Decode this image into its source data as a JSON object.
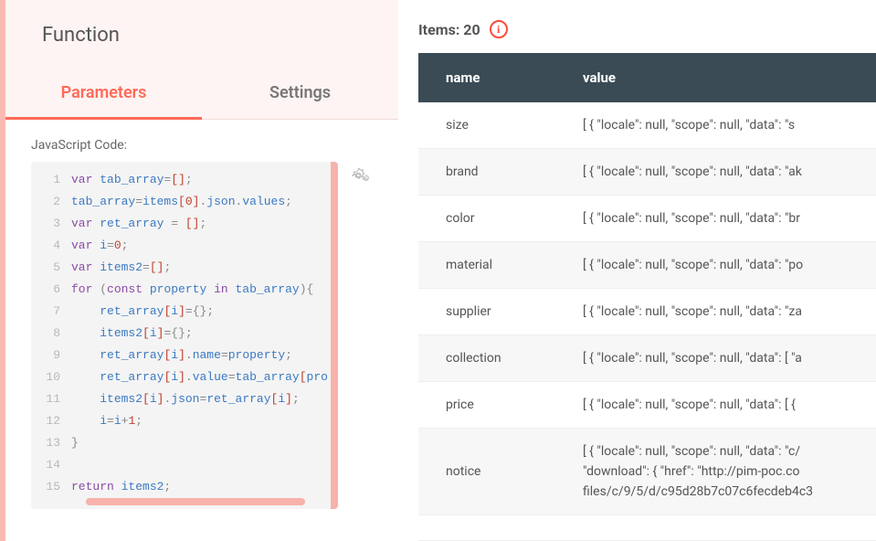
{
  "left": {
    "title": "Function",
    "tabs": {
      "parameters": "Parameters",
      "settings": "Settings"
    },
    "field_label": "JavaScript Code:",
    "code_lines": [
      [
        {
          "t": "var ",
          "c": "kw"
        },
        {
          "t": "tab_array",
          "c": "prop"
        },
        {
          "t": "=",
          "c": "op"
        },
        {
          "t": "[",
          "c": "bracket"
        },
        {
          "t": "]",
          "c": "bracket"
        },
        {
          "t": ";",
          "c": "punct"
        }
      ],
      [
        {
          "t": "tab_array",
          "c": "prop"
        },
        {
          "t": "=",
          "c": "op"
        },
        {
          "t": "items",
          "c": "prop"
        },
        {
          "t": "[",
          "c": "bracket"
        },
        {
          "t": "0",
          "c": "num"
        },
        {
          "t": "]",
          "c": "bracket"
        },
        {
          "t": ".",
          "c": "punct"
        },
        {
          "t": "json",
          "c": "prop"
        },
        {
          "t": ".",
          "c": "punct"
        },
        {
          "t": "values",
          "c": "prop"
        },
        {
          "t": ";",
          "c": "punct"
        }
      ],
      [
        {
          "t": "var ",
          "c": "kw"
        },
        {
          "t": "ret_array ",
          "c": "prop"
        },
        {
          "t": "=",
          "c": "op"
        },
        {
          "t": " ",
          "c": "id"
        },
        {
          "t": "[",
          "c": "bracket"
        },
        {
          "t": "]",
          "c": "bracket"
        },
        {
          "t": ";",
          "c": "punct"
        }
      ],
      [
        {
          "t": "var ",
          "c": "kw"
        },
        {
          "t": "i",
          "c": "prop"
        },
        {
          "t": "=",
          "c": "op"
        },
        {
          "t": "0",
          "c": "num"
        },
        {
          "t": ";",
          "c": "punct"
        }
      ],
      [
        {
          "t": "var ",
          "c": "kw"
        },
        {
          "t": "items2",
          "c": "prop"
        },
        {
          "t": "=",
          "c": "op"
        },
        {
          "t": "[",
          "c": "bracket"
        },
        {
          "t": "]",
          "c": "bracket"
        },
        {
          "t": ";",
          "c": "punct"
        }
      ],
      [
        {
          "t": "for ",
          "c": "kw"
        },
        {
          "t": "(",
          "c": "punct"
        },
        {
          "t": "const ",
          "c": "kw"
        },
        {
          "t": "property ",
          "c": "prop"
        },
        {
          "t": "in ",
          "c": "kw"
        },
        {
          "t": "tab_array",
          "c": "prop"
        },
        {
          "t": ")",
          "c": "punct"
        },
        {
          "t": "{",
          "c": "punct"
        }
      ],
      [
        {
          "t": "    ",
          "c": "id"
        },
        {
          "t": "ret_array",
          "c": "prop"
        },
        {
          "t": "[",
          "c": "bracket"
        },
        {
          "t": "i",
          "c": "prop"
        },
        {
          "t": "]",
          "c": "bracket"
        },
        {
          "t": "=",
          "c": "op"
        },
        {
          "t": "{",
          "c": "punct"
        },
        {
          "t": "}",
          "c": "punct"
        },
        {
          "t": ";",
          "c": "punct"
        }
      ],
      [
        {
          "t": "    ",
          "c": "id"
        },
        {
          "t": "items2",
          "c": "prop"
        },
        {
          "t": "[",
          "c": "bracket"
        },
        {
          "t": "i",
          "c": "prop"
        },
        {
          "t": "]",
          "c": "bracket"
        },
        {
          "t": "=",
          "c": "op"
        },
        {
          "t": "{",
          "c": "punct"
        },
        {
          "t": "}",
          "c": "punct"
        },
        {
          "t": ";",
          "c": "punct"
        }
      ],
      [
        {
          "t": "    ",
          "c": "id"
        },
        {
          "t": "ret_array",
          "c": "prop"
        },
        {
          "t": "[",
          "c": "bracket"
        },
        {
          "t": "i",
          "c": "prop"
        },
        {
          "t": "]",
          "c": "bracket"
        },
        {
          "t": ".",
          "c": "punct"
        },
        {
          "t": "name",
          "c": "prop"
        },
        {
          "t": "=",
          "c": "op"
        },
        {
          "t": "property",
          "c": "prop"
        },
        {
          "t": ";",
          "c": "punct"
        }
      ],
      [
        {
          "t": "    ",
          "c": "id"
        },
        {
          "t": "ret_array",
          "c": "prop"
        },
        {
          "t": "[",
          "c": "bracket"
        },
        {
          "t": "i",
          "c": "prop"
        },
        {
          "t": "]",
          "c": "bracket"
        },
        {
          "t": ".",
          "c": "punct"
        },
        {
          "t": "value",
          "c": "prop"
        },
        {
          "t": "=",
          "c": "op"
        },
        {
          "t": "tab_array",
          "c": "prop"
        },
        {
          "t": "[",
          "c": "bracket"
        },
        {
          "t": "pro",
          "c": "prop"
        }
      ],
      [
        {
          "t": "    ",
          "c": "id"
        },
        {
          "t": "items2",
          "c": "prop"
        },
        {
          "t": "[",
          "c": "bracket"
        },
        {
          "t": "i",
          "c": "prop"
        },
        {
          "t": "]",
          "c": "bracket"
        },
        {
          "t": ".",
          "c": "punct"
        },
        {
          "t": "json",
          "c": "prop"
        },
        {
          "t": "=",
          "c": "op"
        },
        {
          "t": "ret_array",
          "c": "prop"
        },
        {
          "t": "[",
          "c": "bracket"
        },
        {
          "t": "i",
          "c": "prop"
        },
        {
          "t": "]",
          "c": "bracket"
        },
        {
          "t": ";",
          "c": "punct"
        }
      ],
      [
        {
          "t": "    ",
          "c": "id"
        },
        {
          "t": "i",
          "c": "prop"
        },
        {
          "t": "=",
          "c": "op"
        },
        {
          "t": "i",
          "c": "prop"
        },
        {
          "t": "+",
          "c": "op"
        },
        {
          "t": "1",
          "c": "num"
        },
        {
          "t": ";",
          "c": "punct"
        }
      ],
      [
        {
          "t": "}",
          "c": "punct"
        }
      ],
      [],
      [
        {
          "t": "return ",
          "c": "kw"
        },
        {
          "t": "items2",
          "c": "prop"
        },
        {
          "t": ";",
          "c": "punct"
        }
      ]
    ]
  },
  "right": {
    "items_label": "Items:",
    "items_count": "20",
    "alert_char": "i",
    "columns": {
      "name": "name",
      "value": "value"
    },
    "rows": [
      {
        "name": "size",
        "value": "[ { \"locale\": null, \"scope\": null, \"data\": \"s",
        "multi": false
      },
      {
        "name": "brand",
        "value": "[ { \"locale\": null, \"scope\": null, \"data\": \"ak",
        "multi": false
      },
      {
        "name": "color",
        "value": "[ { \"locale\": null, \"scope\": null, \"data\": \"br",
        "multi": false
      },
      {
        "name": "material",
        "value": "[ { \"locale\": null, \"scope\": null, \"data\": \"po",
        "multi": false
      },
      {
        "name": "supplier",
        "value": "[ { \"locale\": null, \"scope\": null, \"data\": \"za",
        "multi": false
      },
      {
        "name": "collection",
        "value": "[ { \"locale\": null, \"scope\": null, \"data\": [ \"a",
        "multi": false
      },
      {
        "name": "price",
        "value": "[ { \"locale\": null, \"scope\": null, \"data\": [ { ",
        "multi": false
      },
      {
        "name": "notice",
        "value": "[ { \"locale\": null, \"scope\": null, \"data\": \"c/\n\"download\": { \"href\": \"http://pim-poc.co\nfiles/c/9/5/d/c95d28b7c07c6fecdeb4c3",
        "multi": true
      }
    ]
  }
}
